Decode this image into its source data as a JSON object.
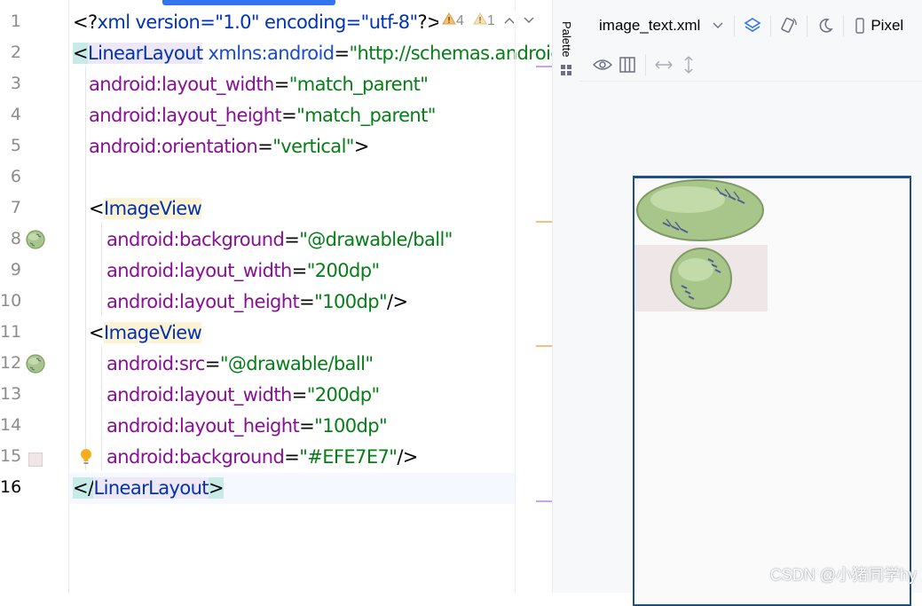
{
  "editor": {
    "line_numbers": [
      "1",
      "2",
      "3",
      "4",
      "5",
      "6",
      "7",
      "8",
      "9",
      "10",
      "11",
      "12",
      "13",
      "14",
      "15",
      "16"
    ],
    "inspection": {
      "warnings": "4",
      "weak_warnings": "1"
    },
    "lines": [
      {
        "xml_open": "<?",
        "xml_name": "xml",
        "xml_attrs": " version=\"1.0\" encoding=\"utf-8\"",
        "xml_close": "?>"
      },
      {
        "open": "<",
        "tag": "LinearLayout",
        "ns_attr": "xmlns:android",
        "eq": "=",
        "val": "\"http://schemas.androic"
      },
      {
        "attr": "android:layout_width",
        "eq": "=",
        "val": "\"match_parent\""
      },
      {
        "attr": "android:layout_height",
        "eq": "=",
        "val": "\"match_parent\""
      },
      {
        "attr": "android:orientation",
        "eq": "=",
        "val": "\"vertical\"",
        "close": ">"
      },
      {
        "blank": ""
      },
      {
        "open": "<",
        "tag": "ImageView"
      },
      {
        "attr": "android:background",
        "eq": "=",
        "val": "\"@drawable/ball\""
      },
      {
        "attr": "android:layout_width",
        "eq": "=",
        "val": "\"200dp\""
      },
      {
        "attr": "android:layout_height",
        "eq": "=",
        "val": "\"100dp\"",
        "close": "/>"
      },
      {
        "open": "<",
        "tag": "ImageView"
      },
      {
        "attr": "android:src",
        "eq": "=",
        "val": "\"@drawable/ball\""
      },
      {
        "attr": "android:layout_width",
        "eq": "=",
        "val": "\"200dp\""
      },
      {
        "attr": "android:layout_height",
        "eq": "=",
        "val": "\"100dp\""
      },
      {
        "attr": "android:background",
        "eq": "=",
        "val": "\"#EFE7E7\"",
        "close": "/>"
      },
      {
        "open": "</",
        "tag": "LinearLayout",
        "close": ">"
      }
    ]
  },
  "palette": {
    "label": "Palette"
  },
  "design": {
    "file_name": "image_text.xml",
    "device_label": "Pixel",
    "image_view_background": "#EFE7E7"
  },
  "watermark": "CSDN @小猪同学hy",
  "colors": {
    "accent": "#3574f0",
    "tag": "#0033b3",
    "attr": "#871094",
    "value": "#067d17"
  }
}
